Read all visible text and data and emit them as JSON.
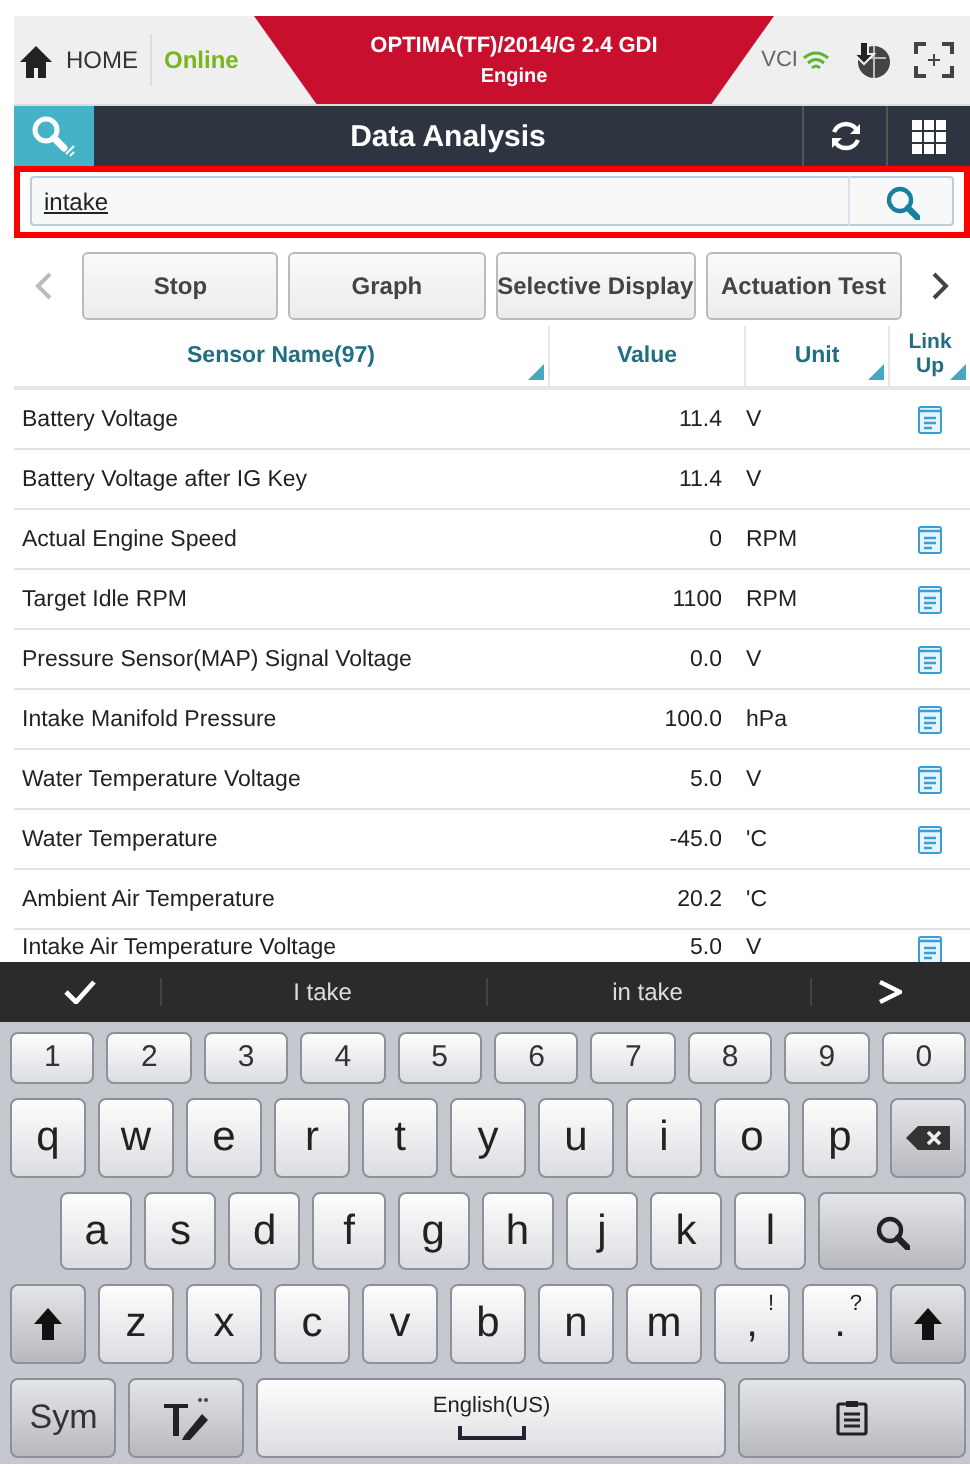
{
  "header": {
    "home": "HOME",
    "status": "Online",
    "vehicle": "OPTIMA(TF)/2014/G 2.4 GDI",
    "system": "Engine",
    "vci": "VCI"
  },
  "title": "Data Analysis",
  "search": {
    "value": "intake"
  },
  "buttons": [
    "Stop",
    "Graph",
    "Selective Display",
    "Actuation Test"
  ],
  "columns": [
    {
      "label": "Sensor Name(97)",
      "sortable": true
    },
    {
      "label": "Value",
      "sortable": false
    },
    {
      "label": "Unit",
      "sortable": true
    },
    {
      "label": "Link Up",
      "sortable": true
    }
  ],
  "rows": [
    {
      "name": "Battery Voltage",
      "value": "11.4",
      "unit": "V",
      "link": true
    },
    {
      "name": "Battery Voltage after IG Key",
      "value": "11.4",
      "unit": "V",
      "link": false
    },
    {
      "name": "Actual Engine Speed",
      "value": "0",
      "unit": "RPM",
      "link": true
    },
    {
      "name": "Target Idle RPM",
      "value": "1100",
      "unit": "RPM",
      "link": true
    },
    {
      "name": "Pressure Sensor(MAP) Signal Voltage",
      "value": "0.0",
      "unit": "V",
      "link": true
    },
    {
      "name": "Intake Manifold Pressure",
      "value": "100.0",
      "unit": "hPa",
      "link": true
    },
    {
      "name": "Water Temperature Voltage",
      "value": "5.0",
      "unit": "V",
      "link": true
    },
    {
      "name": "Water Temperature",
      "value": "-45.0",
      "unit": "'C",
      "link": true
    },
    {
      "name": "Ambient Air Temperature",
      "value": "20.2",
      "unit": "'C",
      "link": false
    },
    {
      "name": "Intake Air Temperature Voltage",
      "value": "5.0",
      "unit": "V",
      "link": true
    }
  ],
  "suggestions": [
    "I take",
    "in take"
  ],
  "keyboard": [
    [
      {
        "kind": "num",
        "label": "1"
      },
      {
        "kind": "num",
        "label": "2"
      },
      {
        "kind": "num",
        "label": "3"
      },
      {
        "kind": "num",
        "label": "4"
      },
      {
        "kind": "num",
        "label": "5"
      },
      {
        "kind": "num",
        "label": "6"
      },
      {
        "kind": "num",
        "label": "7"
      },
      {
        "kind": "num",
        "label": "8"
      },
      {
        "kind": "num",
        "label": "9"
      },
      {
        "kind": "num",
        "label": "0"
      }
    ],
    [
      {
        "kind": "char",
        "label": "q"
      },
      {
        "kind": "char",
        "label": "w"
      },
      {
        "kind": "char",
        "label": "e"
      },
      {
        "kind": "char",
        "label": "r"
      },
      {
        "kind": "char",
        "label": "t"
      },
      {
        "kind": "char",
        "label": "y"
      },
      {
        "kind": "char",
        "label": "u"
      },
      {
        "kind": "char",
        "label": "i"
      },
      {
        "kind": "char",
        "label": "o"
      },
      {
        "kind": "char",
        "label": "p"
      },
      {
        "kind": "backspace"
      }
    ],
    [
      {
        "kind": "char",
        "label": "a"
      },
      {
        "kind": "char",
        "label": "s"
      },
      {
        "kind": "char",
        "label": "d"
      },
      {
        "kind": "char",
        "label": "f"
      },
      {
        "kind": "char",
        "label": "g"
      },
      {
        "kind": "char",
        "label": "h"
      },
      {
        "kind": "char",
        "label": "j"
      },
      {
        "kind": "char",
        "label": "k"
      },
      {
        "kind": "char",
        "label": "l"
      },
      {
        "kind": "search"
      }
    ],
    [
      {
        "kind": "shift"
      },
      {
        "kind": "char",
        "label": "z"
      },
      {
        "kind": "char",
        "label": "x"
      },
      {
        "kind": "char",
        "label": "c"
      },
      {
        "kind": "char",
        "label": "v"
      },
      {
        "kind": "char",
        "label": "b"
      },
      {
        "kind": "char",
        "label": "n"
      },
      {
        "kind": "char",
        "label": "m"
      },
      {
        "kind": "char",
        "label": ",",
        "alt": "!"
      },
      {
        "kind": "char",
        "label": ".",
        "alt": "?"
      },
      {
        "kind": "shift"
      }
    ],
    [
      {
        "kind": "sym",
        "label": "Sym"
      },
      {
        "kind": "handwriting"
      },
      {
        "kind": "space",
        "label": "English(US)"
      },
      {
        "kind": "clipboard"
      }
    ]
  ]
}
